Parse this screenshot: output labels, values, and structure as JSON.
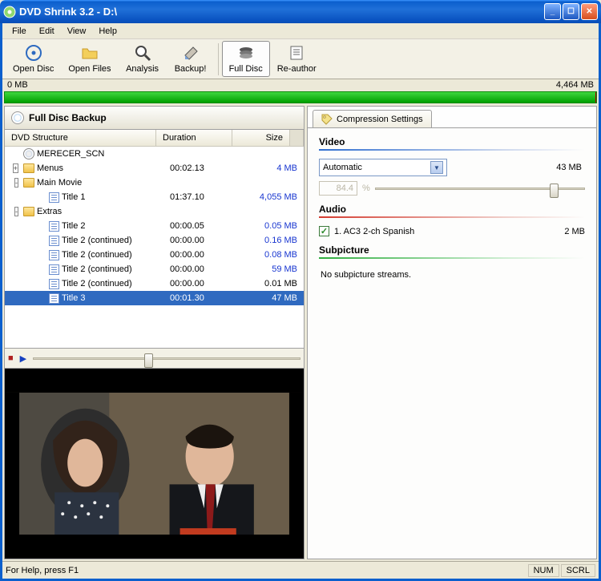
{
  "title": "DVD Shrink 3.2 - D:\\",
  "menu": [
    "File",
    "Edit",
    "View",
    "Help"
  ],
  "toolbar": [
    {
      "id": "open-disc",
      "label": "Open Disc",
      "icon": "disc"
    },
    {
      "id": "open-files",
      "label": "Open Files",
      "icon": "folder"
    },
    {
      "id": "analysis",
      "label": "Analysis",
      "icon": "magnifier"
    },
    {
      "id": "backup",
      "label": "Backup!",
      "icon": "eraser"
    },
    {
      "id": "full-disc",
      "label": "Full Disc",
      "icon": "stack",
      "active": true,
      "sep_before": true
    },
    {
      "id": "re-author",
      "label": "Re-author",
      "icon": "paper"
    }
  ],
  "size_left": "0 MB",
  "size_right": "4,464 MB",
  "left_title": "Full Disc Backup",
  "columns": {
    "name": "DVD Structure",
    "dur": "Duration",
    "size": "Size"
  },
  "tree": [
    {
      "icon": "dvd",
      "name": "MERECER_SCN",
      "exp": null,
      "indent": 0
    },
    {
      "icon": "folder",
      "name": "Menus",
      "exp": "+",
      "indent": 0,
      "dur": "00:02.13",
      "size": "4 MB",
      "blue": true
    },
    {
      "icon": "folder",
      "name": "Main Movie",
      "exp": "-",
      "indent": 0
    },
    {
      "icon": "title",
      "name": "Title 1",
      "indent": 2,
      "dur": "01:37.10",
      "size": "4,055 MB",
      "blue": true
    },
    {
      "icon": "folder",
      "name": "Extras",
      "exp": "-",
      "indent": 0
    },
    {
      "icon": "title",
      "name": "Title 2",
      "indent": 2,
      "dur": "00:00.05",
      "size": "0.05 MB",
      "blue": true
    },
    {
      "icon": "title",
      "name": "Title 2 (continued)",
      "indent": 2,
      "dur": "00:00.00",
      "size": "0.16 MB",
      "blue": true
    },
    {
      "icon": "title",
      "name": "Title 2 (continued)",
      "indent": 2,
      "dur": "00:00.00",
      "size": "0.08 MB",
      "blue": true
    },
    {
      "icon": "title",
      "name": "Title 2 (continued)",
      "indent": 2,
      "dur": "00:00.00",
      "size": "59 MB",
      "blue": true
    },
    {
      "icon": "title",
      "name": "Title 2 (continued)",
      "indent": 2,
      "dur": "00:00.00",
      "size": "0.01 MB"
    },
    {
      "icon": "title",
      "name": "Title 3",
      "indent": 2,
      "dur": "00:01.30",
      "size": "47 MB",
      "selected": true
    }
  ],
  "transport": {
    "knob_percent": 43
  },
  "right": {
    "tab": "Compression Settings",
    "video": {
      "label": "Video",
      "combo": "Automatic",
      "size": "43 MB",
      "pct": "84.4",
      "pct_unit": "%",
      "slider_percent": 85
    },
    "audio": {
      "label": "Audio",
      "items": [
        {
          "checked": true,
          "text": "1. AC3 2-ch Spanish",
          "size": "2 MB"
        }
      ]
    },
    "sub": {
      "label": "Subpicture",
      "msg": "No subpicture streams."
    }
  },
  "status": {
    "help": "For Help, press F1",
    "num": "NUM",
    "scrl": "SCRL"
  }
}
